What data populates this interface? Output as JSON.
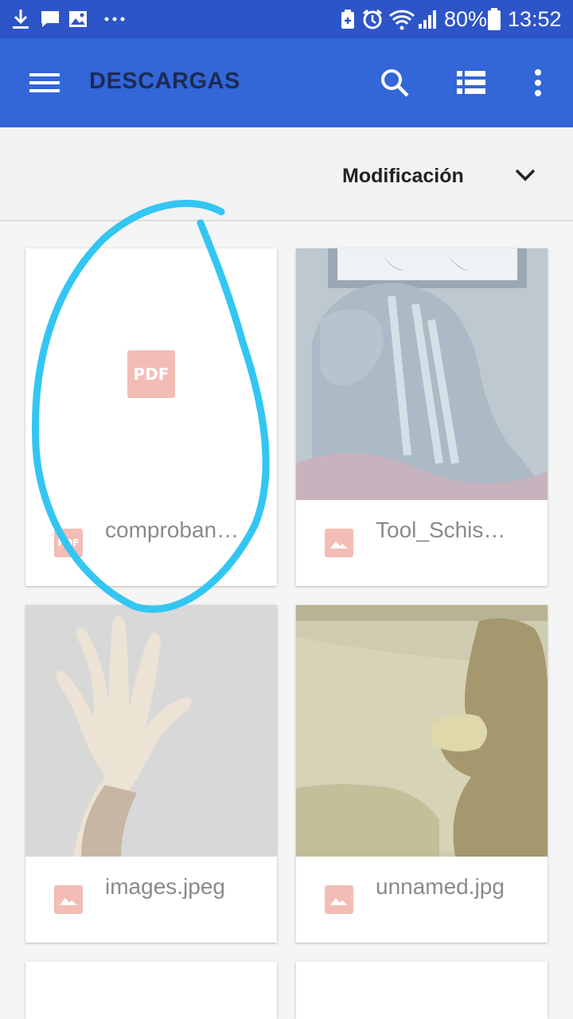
{
  "status_bar": {
    "battery": "80%",
    "time": "13:52",
    "icons": [
      "download-icon",
      "message-icon",
      "image-icon",
      "more-dots-icon",
      "battery-saver-icon",
      "alarm-icon",
      "wifi-icon",
      "signal-icon",
      "battery-icon"
    ]
  },
  "app_bar": {
    "title": "DESCARGAS",
    "icons": [
      "menu-icon",
      "search-icon",
      "list-view-icon",
      "overflow-menu-icon"
    ],
    "color": "#3366d6"
  },
  "sort": {
    "label": "Modificación"
  },
  "files": [
    {
      "name": "comproban…",
      "type": "pdf",
      "thumb_label": "PDF",
      "icon_label": "PDF"
    },
    {
      "name": "Tool_Schis…",
      "type": "image"
    },
    {
      "name": "images.jpeg",
      "type": "image"
    },
    {
      "name": "unnamed.jpg",
      "type": "image"
    }
  ],
  "annotation_color": "#33c6f2"
}
